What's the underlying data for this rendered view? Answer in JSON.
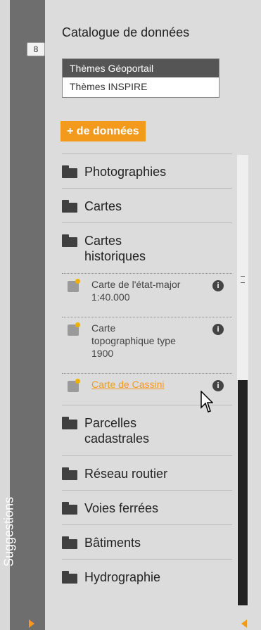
{
  "suggestions": {
    "count": "8",
    "label": "Suggestions"
  },
  "catalog": {
    "title": "Catalogue de données",
    "tabs": [
      {
        "label": "Thèmes Géoportail",
        "active": true
      },
      {
        "label": "Thèmes INSPIRE",
        "active": false
      }
    ],
    "more_data_label": "+ de données"
  },
  "list": {
    "folders": [
      {
        "label": "Photographies"
      },
      {
        "label": "Cartes"
      },
      {
        "label": "Cartes historiques",
        "open": true
      }
    ],
    "layers": [
      {
        "label": "Carte de l'état-major 1:40.000"
      },
      {
        "label": "Carte topographique type 1900"
      },
      {
        "label": "Carte de Cassini",
        "hover": true
      }
    ],
    "more_folders": [
      {
        "label": "Parcelles cadastrales"
      },
      {
        "label": "Réseau routier"
      },
      {
        "label": "Voies ferrées"
      },
      {
        "label": "Bâtiments"
      },
      {
        "label": "Hydrographie"
      }
    ]
  },
  "colors": {
    "accent": "#f39a1d",
    "bar": "#6e6e6e",
    "panel": "#dcdcdc"
  }
}
